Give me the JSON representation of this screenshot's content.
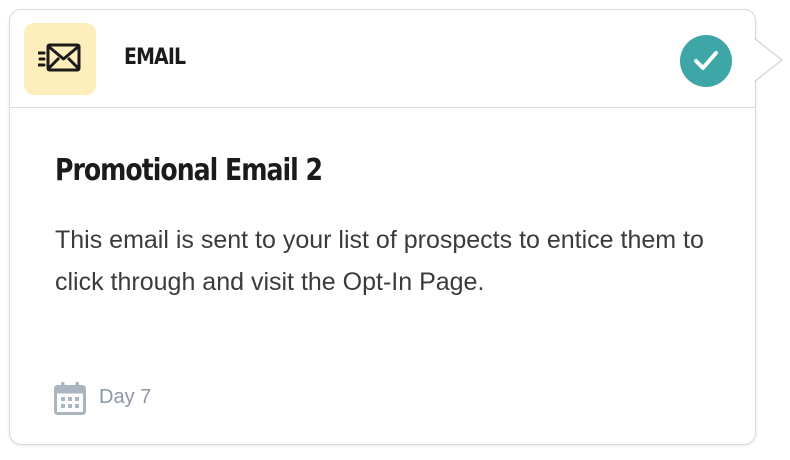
{
  "card": {
    "type_label": "EMAIL",
    "type_icon": "envelope-icon",
    "status_icon": "check-icon",
    "title": "Promotional Email 2",
    "description": "This email is sent to your list of prospects to entice them to click through and visit the Opt-In Page.",
    "schedule_icon": "calendar-icon",
    "schedule_label": "Day 7"
  },
  "colors": {
    "icon_background": "#fdeebb",
    "status_check": "#3ea6a6",
    "title_text": "#1b1b1b",
    "body_text": "#3b3b3b",
    "muted_text": "#8c98a6"
  }
}
